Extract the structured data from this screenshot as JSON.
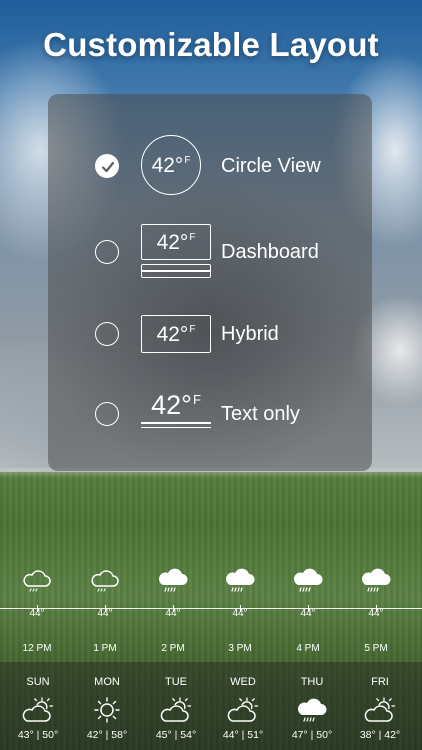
{
  "headline": "Customizable Layout",
  "layout_options": [
    {
      "label": "Circle View",
      "selected": true,
      "preview_temp": "42°",
      "preview_unit": "F"
    },
    {
      "label": "Dashboard",
      "selected": false,
      "preview_temp": "42°",
      "preview_unit": "F"
    },
    {
      "label": "Hybrid",
      "selected": false,
      "preview_temp": "42°",
      "preview_unit": "F"
    },
    {
      "label": "Text only",
      "selected": false,
      "preview_temp": "42°",
      "preview_unit": "F"
    }
  ],
  "hourly": [
    {
      "time": "12 PM",
      "temp": "44°",
      "icon": "cloud-light-rain-icon"
    },
    {
      "time": "1 PM",
      "temp": "44°",
      "icon": "cloud-light-rain-icon"
    },
    {
      "time": "2 PM",
      "temp": "44°",
      "icon": "cloud-rain-icon"
    },
    {
      "time": "3 PM",
      "temp": "44°",
      "icon": "cloud-rain-icon"
    },
    {
      "time": "4 PM",
      "temp": "44°",
      "icon": "cloud-rain-icon"
    },
    {
      "time": "5 PM",
      "temp": "44°",
      "icon": "cloud-rain-icon"
    }
  ],
  "daily": [
    {
      "day": "SUN",
      "range": "43° | 50°",
      "icon": "partly-cloudy-icon"
    },
    {
      "day": "MON",
      "range": "42° | 58°",
      "icon": "sun-icon"
    },
    {
      "day": "TUE",
      "range": "45° | 54°",
      "icon": "partly-cloudy-icon"
    },
    {
      "day": "WED",
      "range": "44° | 51°",
      "icon": "partly-cloudy-icon"
    },
    {
      "day": "THU",
      "range": "47° | 50°",
      "icon": "cloud-rain-icon"
    },
    {
      "day": "FRI",
      "range": "38° | 42°",
      "icon": "partly-cloudy-icon"
    }
  ]
}
